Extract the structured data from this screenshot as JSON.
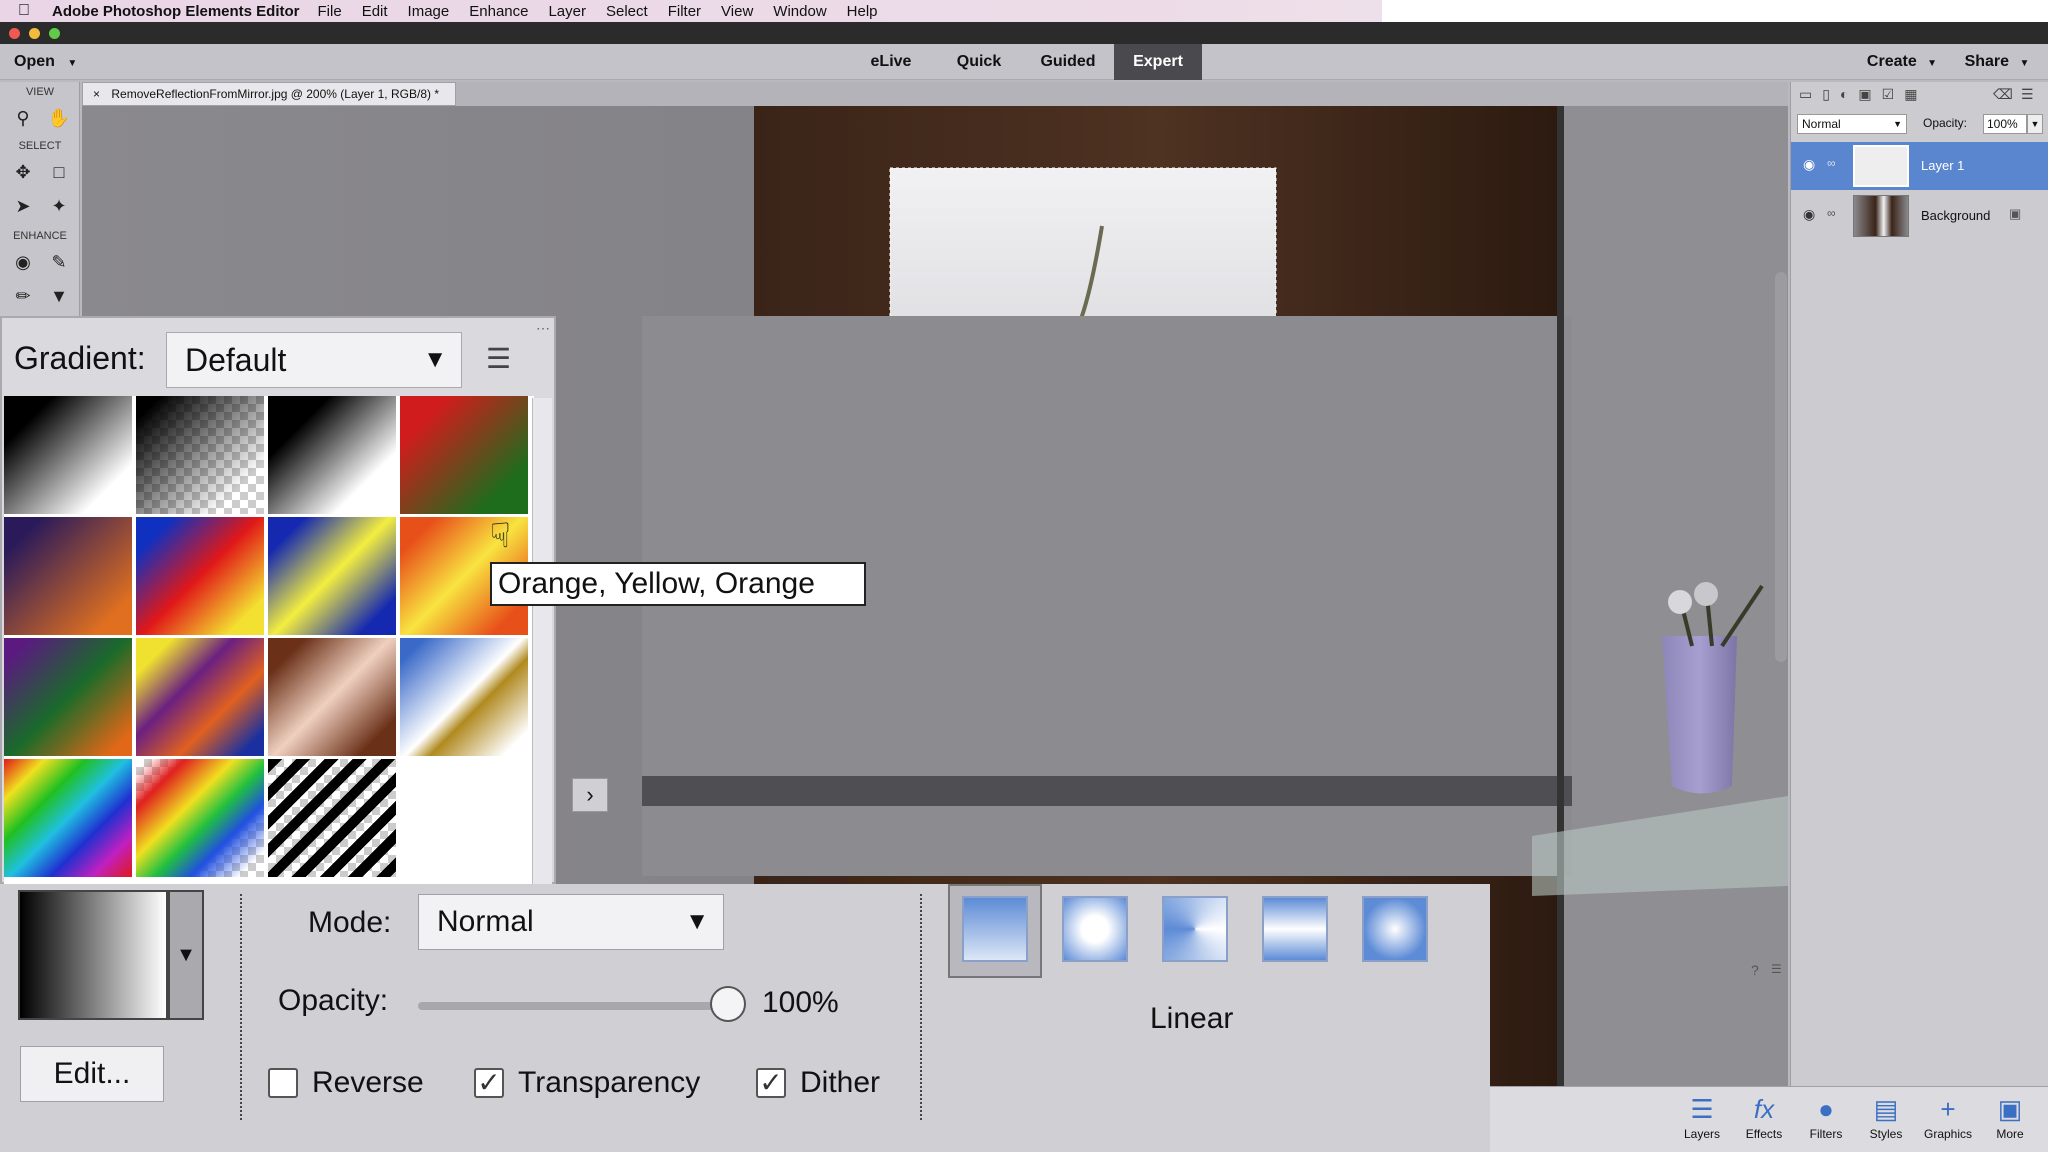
{
  "menubar": {
    "app_name": "Adobe Photoshop Elements Editor",
    "items": [
      "File",
      "Edit",
      "Image",
      "Enhance",
      "Layer",
      "Select",
      "Filter",
      "View",
      "Window",
      "Help"
    ]
  },
  "modebar": {
    "open_label": "Open",
    "tabs": [
      "eLive",
      "Quick",
      "Guided",
      "Expert"
    ],
    "active_tab": "Expert",
    "create_label": "Create",
    "share_label": "Share"
  },
  "toolbox": {
    "view_label": "VIEW",
    "select_label": "SELECT",
    "enhance_label": "ENHANCE"
  },
  "document": {
    "tab_title": "RemoveReflectionFromMirror.jpg @ 200% (Layer 1, RGB/8) *",
    "close_glyph": "×"
  },
  "layers_panel": {
    "blend_mode": "Normal",
    "opacity_label": "Opacity:",
    "opacity_value": "100%",
    "layers": [
      {
        "name": "Layer 1",
        "selected": true
      },
      {
        "name": "Background",
        "selected": false
      }
    ]
  },
  "gradient_picker": {
    "label": "Gradient:",
    "preset_set": "Default",
    "tooltip": "Orange, Yellow, Orange",
    "swatch_icons": [
      "foreground-to-background",
      "foreground-to-transparent",
      "black-white",
      "red-green",
      "violet-orange",
      "blue-red-yellow",
      "blue-yellow-blue",
      "orange-yellow-orange",
      "violet-green-orange",
      "yellow-violet-orange-blue",
      "copper",
      "chrome",
      "spectrum",
      "transparent-rainbow",
      "transparent-stripes",
      "empty"
    ]
  },
  "tool_options": {
    "edit_label": "Edit...",
    "mode_label": "Mode:",
    "mode_value": "Normal",
    "opacity_label": "Opacity:",
    "opacity_value": "100%",
    "opacity_level": 1.0,
    "reverse_label": "Reverse",
    "reverse_checked": false,
    "transparency_label": "Transparency",
    "transparency_checked": true,
    "dither_label": "Dither",
    "dither_checked": true,
    "gradient_type_label": "Linear",
    "gradient_types": [
      "linear",
      "radial",
      "angle",
      "reflected",
      "diamond"
    ],
    "selected_type": "linear"
  },
  "bottom_bar": {
    "items": [
      "Layers",
      "Effects",
      "Filters",
      "Styles",
      "Graphics",
      "More"
    ]
  },
  "colors": {
    "accent": "#4a78c8",
    "selected_layer": "#5a86d0"
  }
}
